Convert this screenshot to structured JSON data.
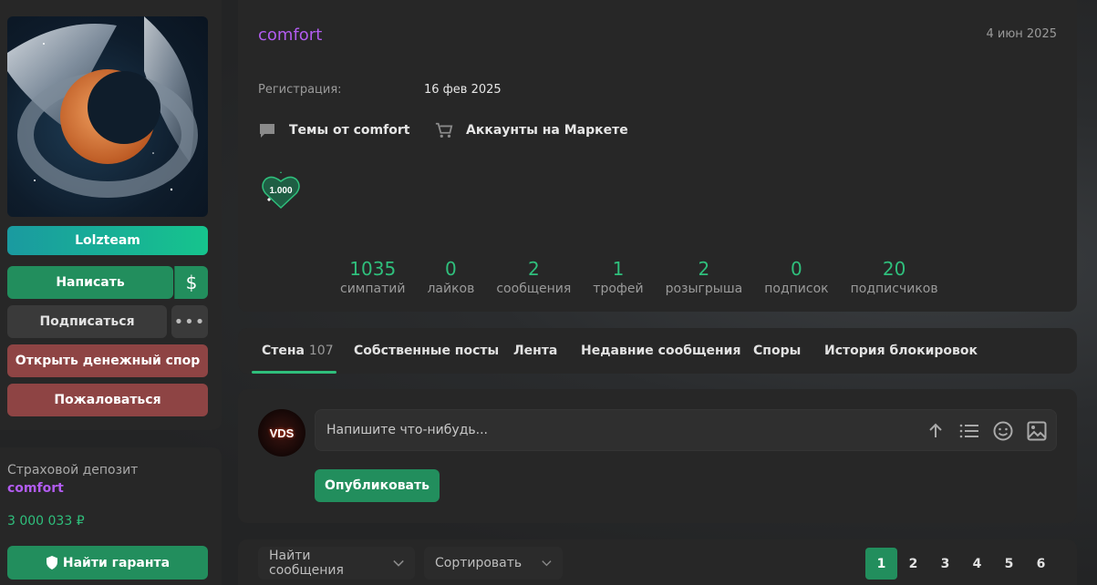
{
  "sidebar": {
    "buttons": {
      "team": "Lolzteam",
      "write": "Написать",
      "dollar": "$",
      "subscribe": "Подписаться",
      "more": "•••",
      "dispute": "Открыть денежный спор",
      "report": "Пожаловаться"
    },
    "deposit": {
      "title": "Страховой депозит",
      "name": "comfort",
      "amount": "3 000 033 ₽",
      "guarantor_button": "Найти гаранта"
    }
  },
  "profile": {
    "username": "comfort",
    "date": "4 июн 2025",
    "registration_label": "Регистрация:",
    "registration_value": "16 фев 2025",
    "links": {
      "topics": "Темы от comfort",
      "market": "Аккаунты на Маркете"
    },
    "trophy_text": "1.000",
    "stats": [
      {
        "value": "1035",
        "label": "симпатий"
      },
      {
        "value": "0",
        "label": "лайков"
      },
      {
        "value": "2",
        "label": "сообщения"
      },
      {
        "value": "1",
        "label": "трофей"
      },
      {
        "value": "2",
        "label": "розыгрыша"
      },
      {
        "value": "0",
        "label": "подписок"
      },
      {
        "value": "20",
        "label": "подписчиков"
      }
    ]
  },
  "tabs": {
    "wall": "Стена",
    "wall_count": "107",
    "own_posts": "Собственные посты",
    "feed": "Лента",
    "recent": "Недавние сообщения",
    "disputes": "Споры",
    "bans": "История блокировок"
  },
  "post": {
    "avatar_text": "VDS",
    "placeholder": "Напишите что-нибудь...",
    "publish": "Опубликовать"
  },
  "filters": {
    "find": "Найти сообщения",
    "sort": "Сортировать",
    "pages": [
      "1",
      "2",
      "3",
      "4",
      "5",
      "6"
    ],
    "active_page": "1"
  },
  "colors": {
    "accent_green": "#228e5d",
    "stat_green": "#2fbf7c",
    "username_purple": "#b25cf0",
    "danger_red": "#8e4444"
  }
}
